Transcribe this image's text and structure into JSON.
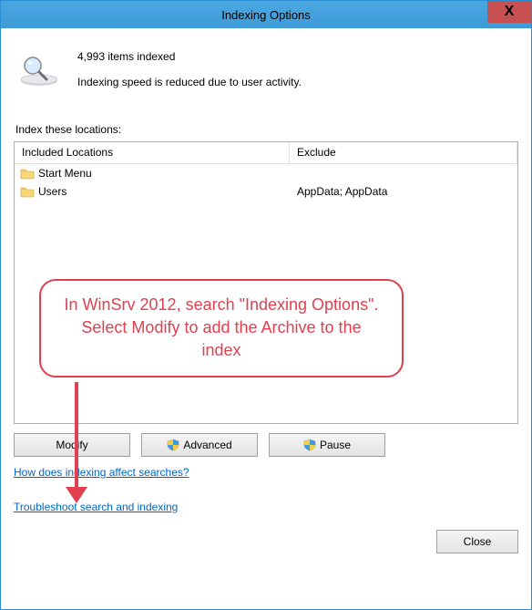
{
  "window": {
    "title": "Indexing Options",
    "close_glyph": "X"
  },
  "status": {
    "count_line": "4,993 items indexed",
    "speed_line": "Indexing speed is reduced due to user activity."
  },
  "section_label": "Index these locations:",
  "table": {
    "header_included": "Included Locations",
    "header_exclude": "Exclude",
    "rows": [
      {
        "included": "Start Menu",
        "exclude": ""
      },
      {
        "included": "Users",
        "exclude": "AppData; AppData"
      }
    ]
  },
  "buttons": {
    "modify": "Modify",
    "advanced": "Advanced",
    "pause": "Pause",
    "close": "Close"
  },
  "links": {
    "how": "How does indexing affect searches?",
    "troubleshoot": "Troubleshoot search and indexing"
  },
  "annotation": {
    "text": "In WinSrv 2012, search \"Indexing Options\". Select Modify to add the Archive to the index"
  },
  "colors": {
    "accent": "#3d9bd8",
    "annotation": "#e04050",
    "link": "#0066cc"
  }
}
